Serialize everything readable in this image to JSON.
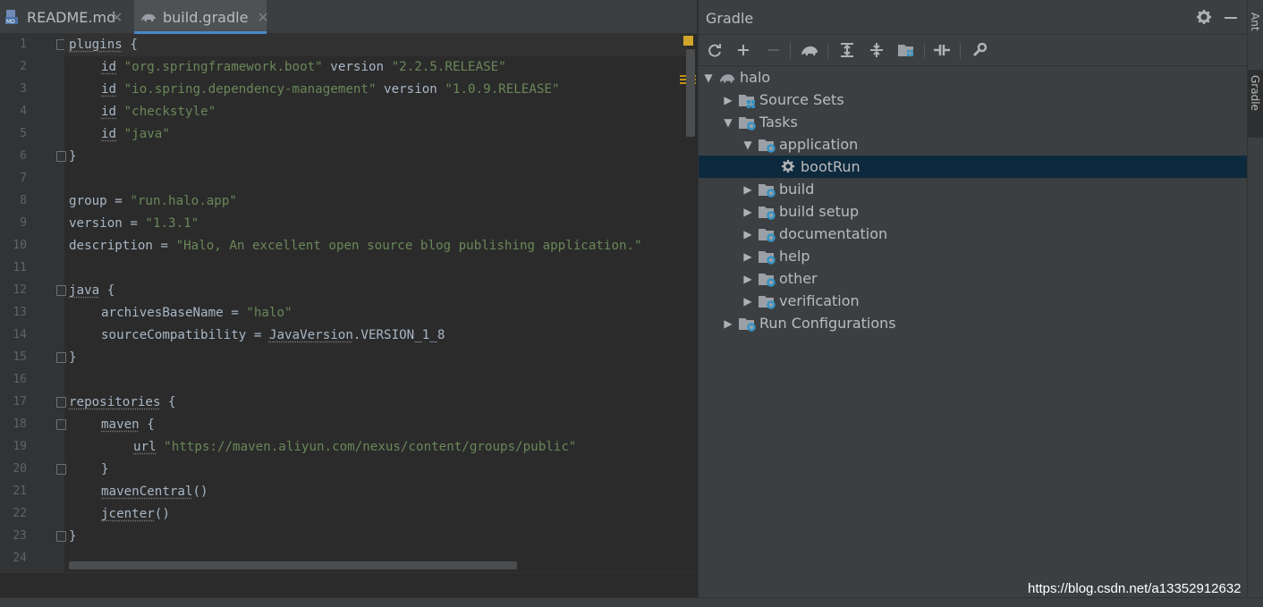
{
  "tabs": [
    {
      "label": "README.md",
      "icon": "markdown-file-icon"
    },
    {
      "label": "build.gradle",
      "icon": "gradle-file-icon"
    }
  ],
  "editor": {
    "line_numbers": [
      "1",
      "2",
      "3",
      "4",
      "5",
      "6",
      "7",
      "8",
      "9",
      "10",
      "11",
      "12",
      "13",
      "14",
      "15",
      "16",
      "17",
      "18",
      "19",
      "20",
      "21",
      "22",
      "23",
      "24"
    ],
    "lines": {
      "l1": {
        "kw": "plugins",
        "rest": " {"
      },
      "l2": {
        "id": "id",
        "s1": "\"org.springframework.boot\"",
        "v": " version ",
        "s2": "\"2.2.5.RELEASE\""
      },
      "l3": {
        "id": "id",
        "s1": "\"io.spring.dependency-management\"",
        "v": " version ",
        "s2": "\"1.0.9.RELEASE\""
      },
      "l4": {
        "id": "id",
        "s1": "\"checkstyle\""
      },
      "l5": {
        "id": "id",
        "s1": "\"java\""
      },
      "l6": {
        "text": "}"
      },
      "l8": {
        "k": "group = ",
        "s": "\"run.halo.app\""
      },
      "l9": {
        "k": "version = ",
        "s": "\"1.3.1\""
      },
      "l10": {
        "k": "description = ",
        "s": "\"Halo, An excellent open source blog publishing application.\""
      },
      "l12": {
        "kw": "java",
        "rest": " {"
      },
      "l13": {
        "k": "archivesBaseName = ",
        "s": "\"halo\""
      },
      "l14": {
        "k": "sourceCompatibility = ",
        "u": "JavaVersion",
        "rest": ".VERSION_1_8"
      },
      "l15": {
        "text": "}"
      },
      "l17": {
        "kw": "repositories",
        "rest": " {"
      },
      "l18": {
        "kw": "maven",
        "rest": " {"
      },
      "l19": {
        "kw": "url",
        "s": " \"https://maven.aliyun.com/nexus/content/groups/public\""
      },
      "l20": {
        "text": "}"
      },
      "l21": {
        "kw": "mavenCentral",
        "rest": "()"
      },
      "l22": {
        "kw": "jcenter",
        "rest": "()"
      },
      "l23": {
        "text": "}"
      }
    }
  },
  "gradle_panel": {
    "title": "Gradle",
    "toolbar": [
      "refresh-icon",
      "add-icon",
      "remove-icon",
      "gradle-elephant-icon",
      "expand-all-icon",
      "collapse-all-icon",
      "group-modules-icon",
      "toggle-offline-icon",
      "settings-wrench-icon"
    ],
    "tree": {
      "root": "halo",
      "source_sets": "Source Sets",
      "tasks": "Tasks",
      "application": "application",
      "bootrun": "bootRun",
      "build": "build",
      "build_setup": "build setup",
      "documentation": "documentation",
      "help": "help",
      "other": "other",
      "verification": "verification",
      "run_configurations": "Run Configurations"
    }
  },
  "side_tabs": {
    "ant": "Ant",
    "gradle": "Gradle"
  },
  "watermark": "https://blog.csdn.net/a13352912632",
  "colors": {
    "selection": "#0d293e",
    "string": "#6a8759",
    "text": "#a9b7c6",
    "accent": "#4a88c7"
  }
}
